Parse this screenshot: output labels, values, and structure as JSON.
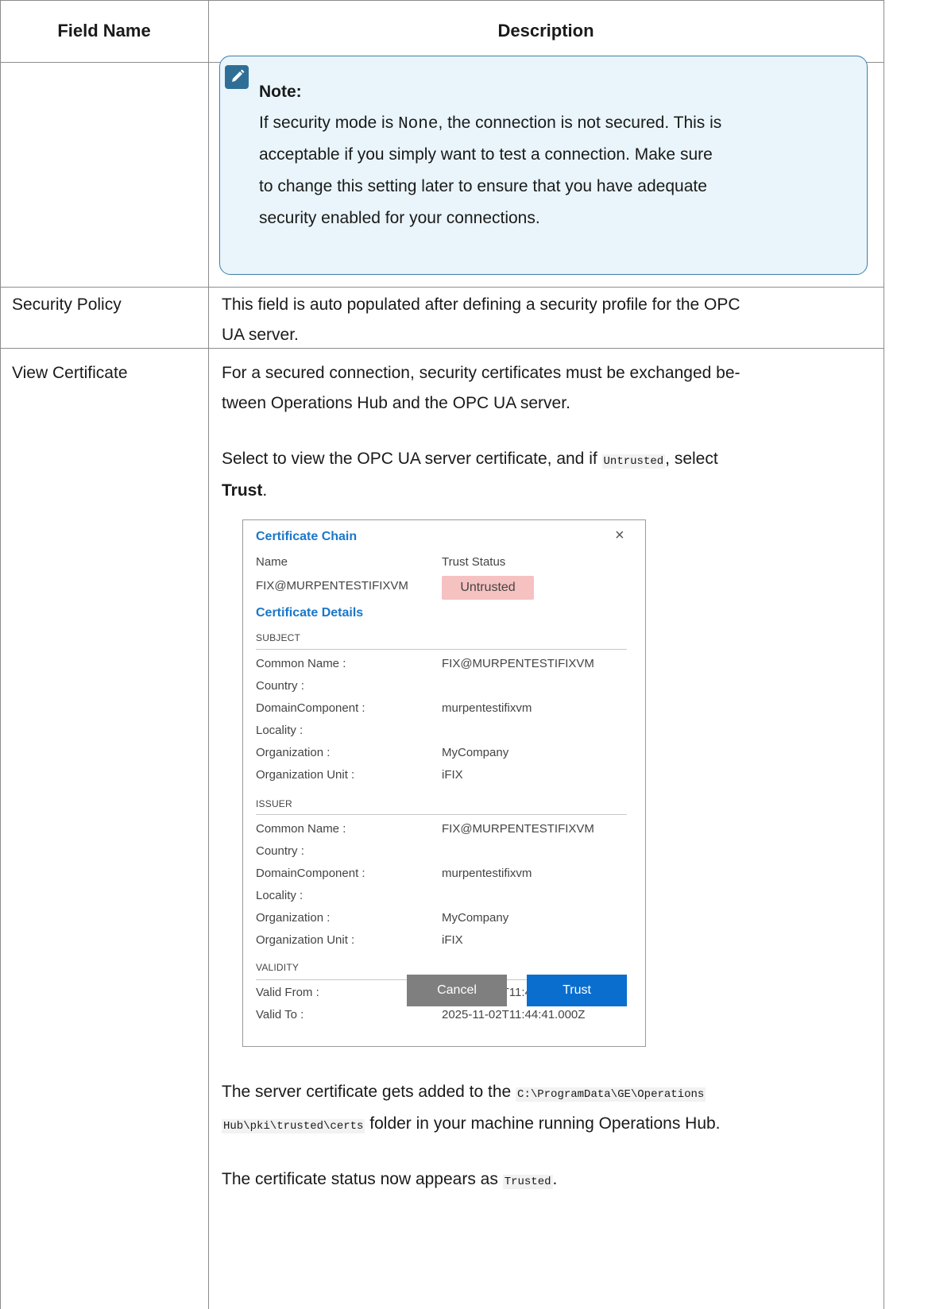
{
  "table": {
    "header_field": "Field Name",
    "header_description": "Description"
  },
  "note": {
    "title": "Note:",
    "line1_pre": "If security mode is ",
    "line1_code": "None",
    "line1_post": ", the connection is not secured. This is",
    "line2": "acceptable if you simply want to test a connection. Make sure",
    "line3": "to change this setting later to ensure that you have adequate",
    "line4": "security enabled for your connections."
  },
  "rows": {
    "security_policy": {
      "name": "Security Policy",
      "line1": "This field is auto populated after defining a security profile for the OPC",
      "line2": "UA server."
    },
    "view_certificate": {
      "name": "View Certificate",
      "p1_line1": "For a secured connection, security certificates must be exchanged be-",
      "p1_line2": "tween Operations Hub and the OPC UA server.",
      "p2_pre": "Select to view the OPC UA server certificate, and if ",
      "p2_code": "Untrusted",
      "p2_post": ", select",
      "p2_bold": "Trust",
      "p2_end": ".",
      "p3_line1_pre": "The server certificate gets added to the ",
      "p3_line1_code": "C:\\ProgramData\\GE\\Operations",
      "p3_line2_code": "Hub\\pki\\trusted\\certs",
      "p3_line2_post": " folder in your machine running Operations Hub.",
      "p4_pre": "The certificate status now appears as ",
      "p4_code": "Trusted",
      "p4_end": "."
    }
  },
  "dialog": {
    "title": "Certificate Chain",
    "close_glyph": "×",
    "col_name": "Name",
    "col_trust": "Trust Status",
    "cert_name": "FIX@MURPENTESTIFIXVM",
    "trust_status": "Untrusted",
    "details_title": "Certificate Details",
    "subject": {
      "heading": "SUBJECT",
      "common_name_label": "Common Name :",
      "common_name": "FIX@MURPENTESTIFIXVM",
      "country_label": "Country :",
      "domain_label": "DomainComponent :",
      "domain": "murpentestifixvm",
      "locality_label": "Locality :",
      "org_label": "Organization :",
      "org": "MyCompany",
      "org_unit_label": "Organization Unit :",
      "org_unit": "iFIX"
    },
    "issuer": {
      "heading": "ISSUER",
      "common_name_label": "Common Name :",
      "common_name": "FIX@MURPENTESTIFIXVM",
      "country_label": "Country :",
      "domain_label": "DomainComponent :",
      "domain": "murpentestifixvm",
      "locality_label": "Locality :",
      "org_label": "Organization :",
      "org": "MyCompany",
      "org_unit_label": "Organization Unit :",
      "org_unit": "iFIX"
    },
    "validity": {
      "heading": "VALIDITY",
      "from_label": "Valid From :",
      "from": "2020-11-03T11:44:41.000Z",
      "to_label": "Valid To :",
      "to": "2025-11-02T11:44:41.000Z"
    },
    "cancel_label": "Cancel",
    "trust_label": "Trust"
  }
}
